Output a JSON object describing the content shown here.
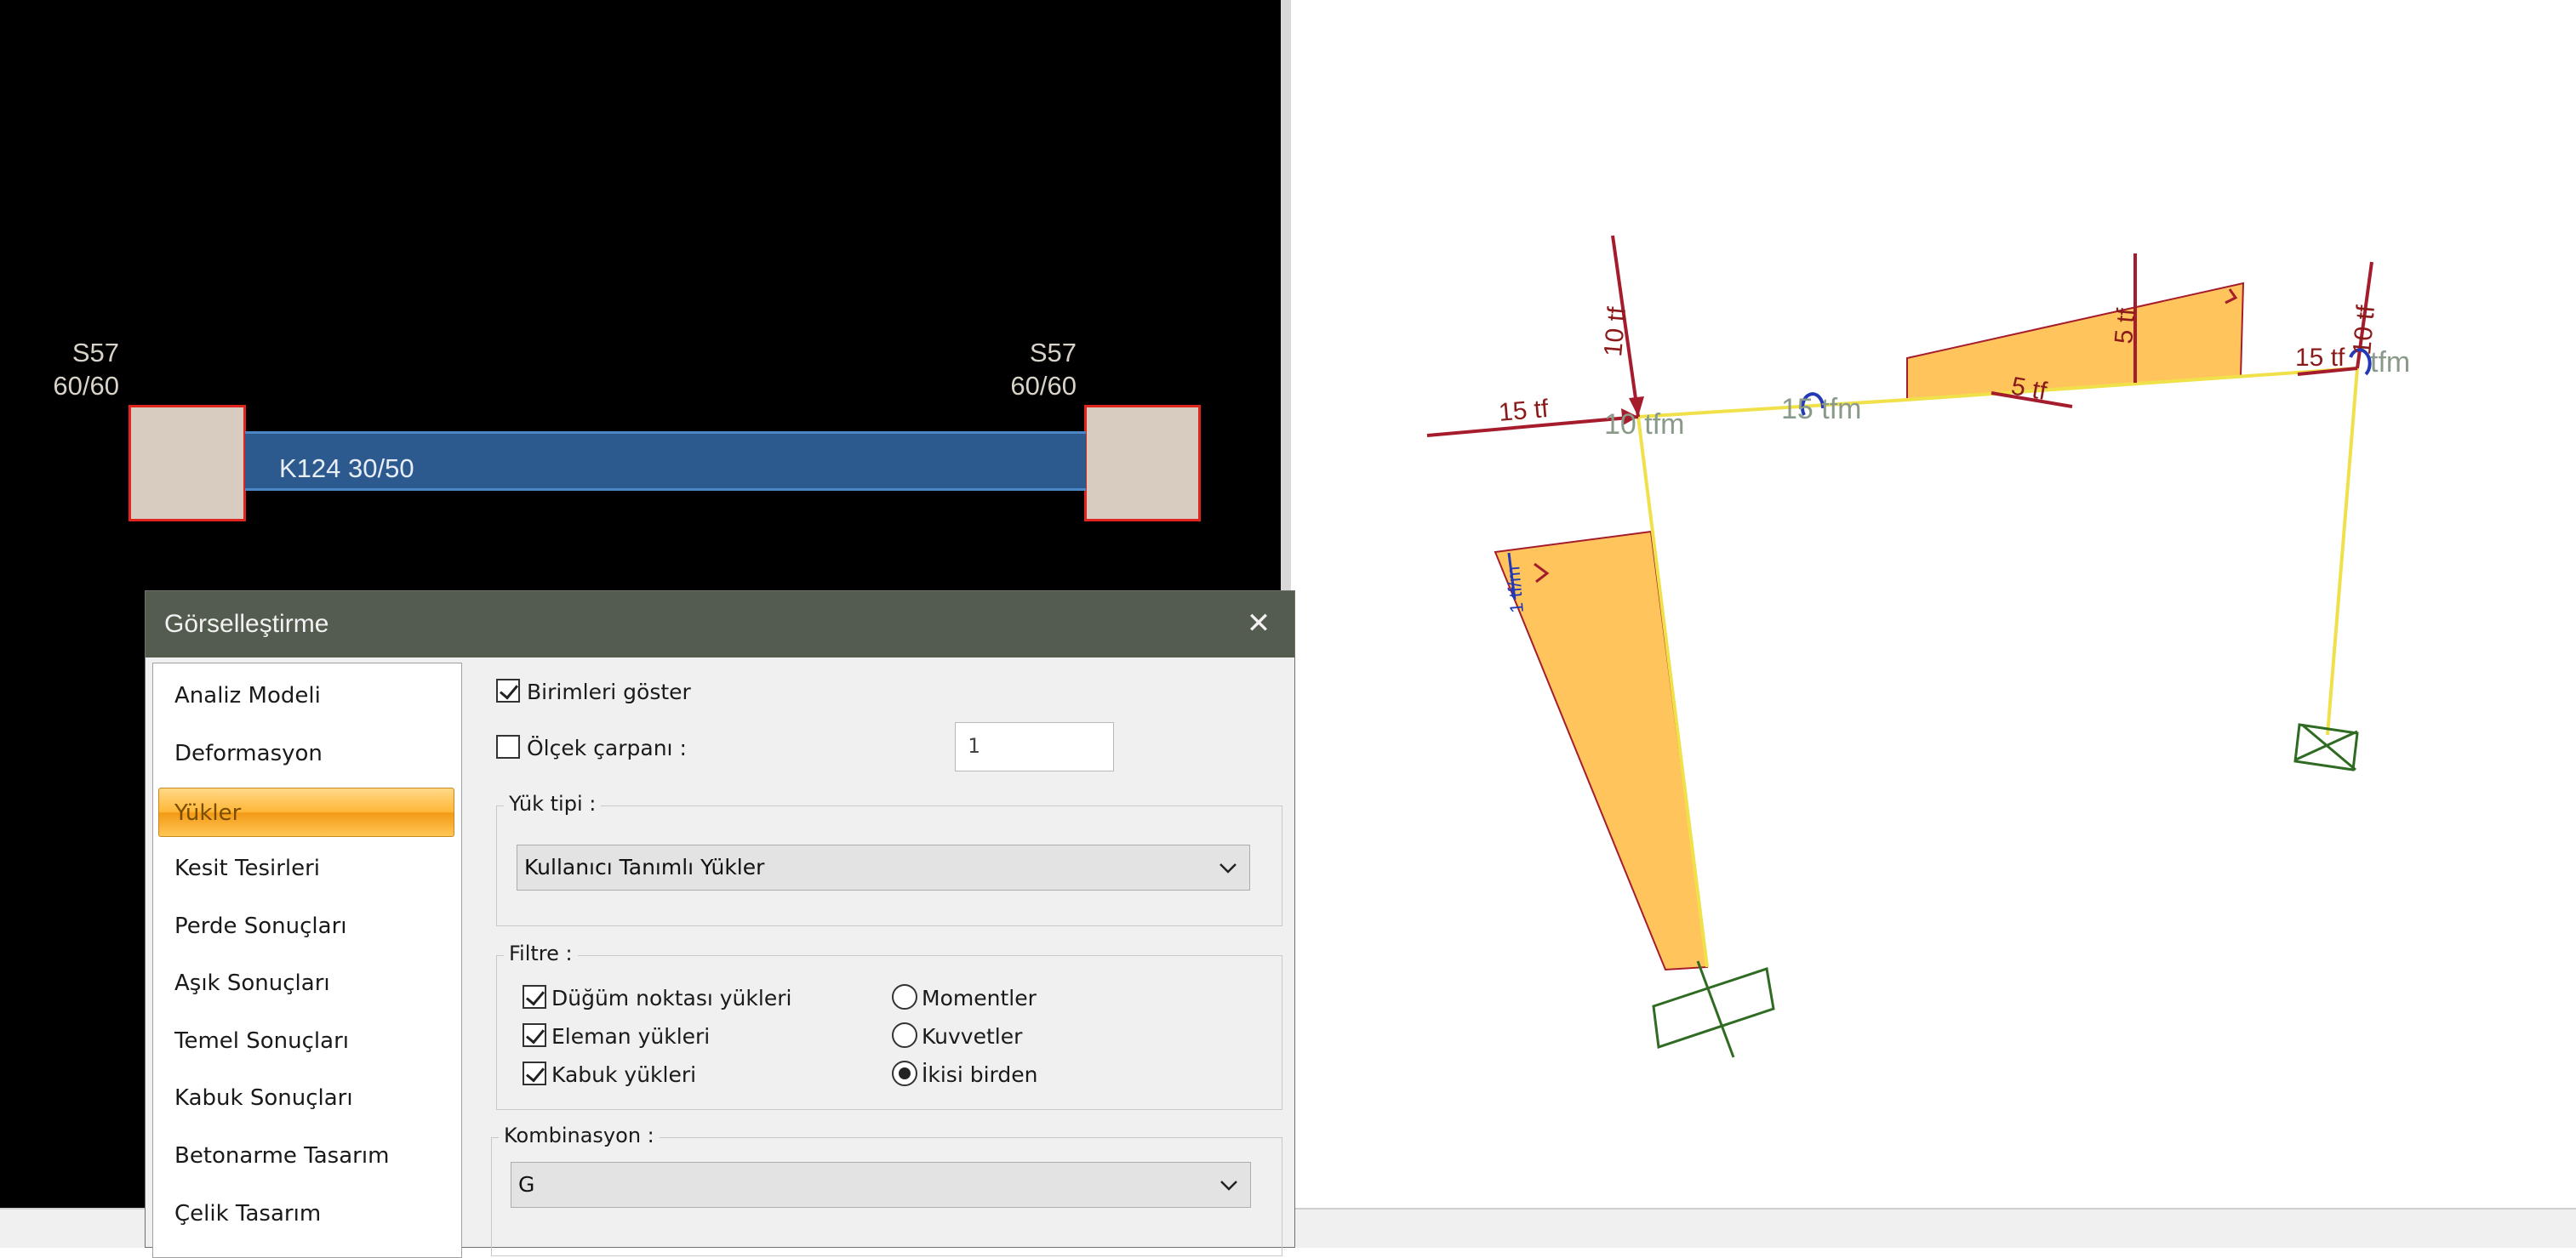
{
  "left_view": {
    "columns": [
      {
        "name": "S57",
        "size": "60/60"
      },
      {
        "name": "S57",
        "size": "60/60"
      }
    ],
    "beam_label": "K124 30/50"
  },
  "right_view": {
    "loads": {
      "top_left_horizontal": "15 tf",
      "top_left_vertical": "10 tf",
      "moment_left": "10 tfm",
      "moment_mid": "15 tfm",
      "dist_5tf_a": "5 tf",
      "dist_5tf_b": "5 tf",
      "top_right_horizontal": "15 tf",
      "top_right_vertical": "10 tf",
      "moment_right": "tfm",
      "small_left": "1 tf/m"
    },
    "colors": {
      "frame": "#f0e14a",
      "load_fill": "#ffc55c",
      "load_line": "#a51d2d",
      "support": "#2f6b22"
    }
  },
  "dialog": {
    "title": "Görselleştirme",
    "close_icon": "close-icon",
    "nav": [
      {
        "label": "Analiz Modeli",
        "active": false
      },
      {
        "label": "Deformasyon",
        "active": false
      },
      {
        "label": "Yükler",
        "active": true
      },
      {
        "label": "Kesit Tesirleri",
        "active": false
      },
      {
        "label": "Perde Sonuçları",
        "active": false
      },
      {
        "label": "Aşık Sonuçları",
        "active": false
      },
      {
        "label": "Temel Sonuçları",
        "active": false
      },
      {
        "label": "Kabuk Sonuçları",
        "active": false
      },
      {
        "label": "Betonarme Tasarım",
        "active": false
      },
      {
        "label": "Çelik Tasarım",
        "active": false
      }
    ],
    "show_units": {
      "label": "Birimleri göster",
      "checked": true
    },
    "scale": {
      "label": "Ölçek çarpanı :",
      "checked": false,
      "value": "1"
    },
    "load_type": {
      "title": "Yük tipi :",
      "selected": "Kullanıcı Tanımlı Yükler"
    },
    "filter": {
      "title": "Filtre :",
      "checks": [
        {
          "label": "Düğüm noktası yükleri",
          "checked": true
        },
        {
          "label": "Eleman yükleri",
          "checked": true
        },
        {
          "label": "Kabuk yükleri",
          "checked": true
        }
      ],
      "radios": [
        {
          "label": "Momentler",
          "checked": false
        },
        {
          "label": "Kuvvetler",
          "checked": false
        },
        {
          "label": "İkisi birden",
          "checked": true
        }
      ]
    },
    "combination": {
      "title": "Kombinasyon :",
      "selected": "G"
    }
  }
}
